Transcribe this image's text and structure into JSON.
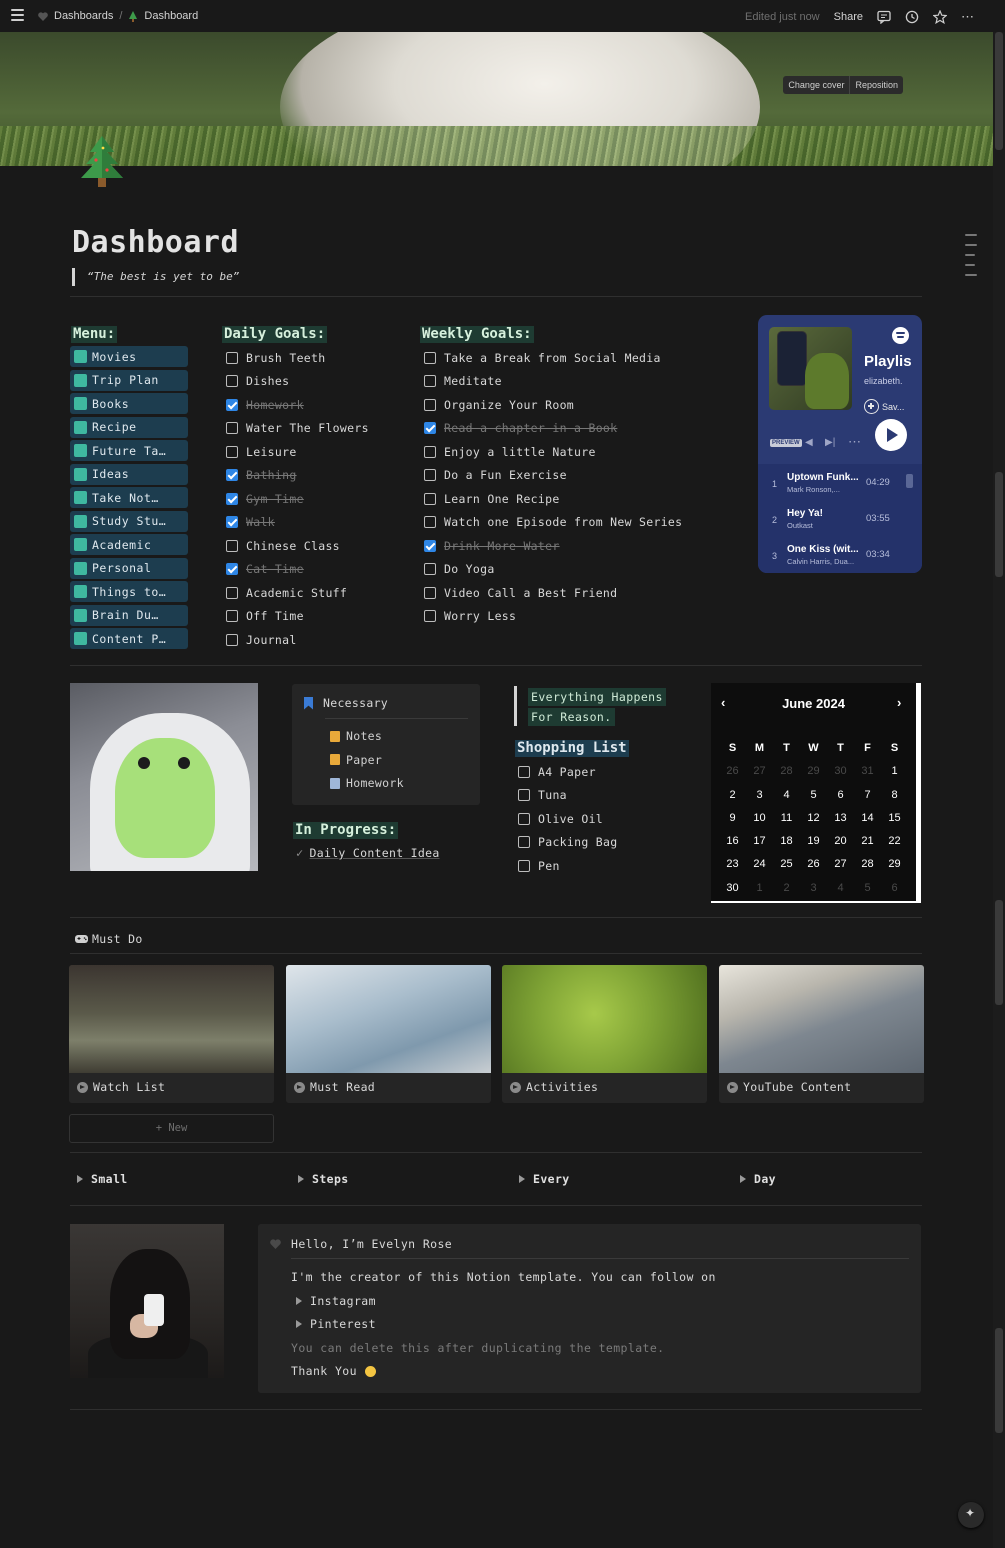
{
  "topbar": {
    "crumb1": "Dashboards",
    "crumb2": "Dashboard",
    "edited": "Edited just now",
    "share": "Share"
  },
  "cover": {
    "change": "Change cover",
    "reposition": "Reposition"
  },
  "page": {
    "title": "Dashboard",
    "quote": "“The best is yet to be”"
  },
  "menu": {
    "heading": "Menu:",
    "items": [
      {
        "label": "Movies",
        "color": "#3fb8a0"
      },
      {
        "label": "Trip Plan",
        "color": "#3fb8a0"
      },
      {
        "label": "Books",
        "color": "#3fb8a0"
      },
      {
        "label": "Recipe",
        "color": "#3fb8a0"
      },
      {
        "label": "Future Ta…",
        "color": "#3fb8a0"
      },
      {
        "label": "Ideas",
        "color": "#3fb8a0"
      },
      {
        "label": "Take Not…",
        "color": "#3fb8a0"
      },
      {
        "label": "Study Stu…",
        "color": "#3fb8a0"
      },
      {
        "label": "Academic",
        "color": "#3fb8a0"
      },
      {
        "label": "Personal",
        "color": "#3fb8a0"
      },
      {
        "label": "Things to…",
        "color": "#3fb8a0"
      },
      {
        "label": "Brain Du…",
        "color": "#3fb8a0"
      },
      {
        "label": "Content P…",
        "color": "#3fb8a0"
      }
    ]
  },
  "daily": {
    "heading": "Daily Goals:",
    "items": [
      {
        "label": "Brush Teeth",
        "done": false
      },
      {
        "label": "Dishes",
        "done": false
      },
      {
        "label": "Homework",
        "done": true
      },
      {
        "label": "Water The Flowers",
        "done": false
      },
      {
        "label": "Leisure",
        "done": false
      },
      {
        "label": "Bathing",
        "done": true
      },
      {
        "label": "Gym Time",
        "done": true
      },
      {
        "label": "Walk",
        "done": true
      },
      {
        "label": "Chinese Class",
        "done": false
      },
      {
        "label": "Cat Time",
        "done": true
      },
      {
        "label": "Academic Stuff",
        "done": false
      },
      {
        "label": "Off Time",
        "done": false
      },
      {
        "label": "Journal",
        "done": false
      }
    ]
  },
  "weekly": {
    "heading": "Weekly Goals:",
    "items": [
      {
        "label": "Take a Break from Social Media",
        "done": false
      },
      {
        "label": "Meditate",
        "done": false
      },
      {
        "label": "Organize Your Room",
        "done": false
      },
      {
        "label": "Read a chapter in a Book",
        "done": true
      },
      {
        "label": "Enjoy a little Nature",
        "done": false
      },
      {
        "label": "Do a Fun Exercise",
        "done": false
      },
      {
        "label": "Learn One Recipe",
        "done": false
      },
      {
        "label": "Watch one Episode from New Series",
        "done": false
      },
      {
        "label": "Drink More Water",
        "done": true
      },
      {
        "label": "Do Yoga",
        "done": false
      },
      {
        "label": "Video Call a Best Friend",
        "done": false
      },
      {
        "label": "Worry Less",
        "done": false
      }
    ]
  },
  "spotify": {
    "title": "Playlis",
    "user": "elizabeth.",
    "save": "Sav...",
    "preview": "PREVIEW",
    "tracks": [
      {
        "n": "1",
        "name": "Uptown Funk...",
        "artist": "Mark Ronson,...",
        "dur": "04:29"
      },
      {
        "n": "2",
        "name": "Hey Ya!",
        "artist": "Outkast",
        "dur": "03:55"
      },
      {
        "n": "3",
        "name": "One Kiss (wit...",
        "artist": "Calvin Harris, Dua...",
        "dur": "03:34"
      }
    ]
  },
  "necessary": {
    "title": "Necessary",
    "items": [
      {
        "label": "Notes",
        "color": "#e8a93a"
      },
      {
        "label": "Paper",
        "color": "#e8a93a"
      },
      {
        "label": "Homework",
        "color": "#9fb7d8"
      }
    ]
  },
  "inprogress": {
    "heading": "In Progress:",
    "item": "Daily Content Idea"
  },
  "quote2": {
    "line1": "Everything Happens",
    "line2": "For Reason."
  },
  "shopping": {
    "heading": "Shopping List",
    "items": [
      "A4 Paper",
      "Tuna",
      "Olive Oil",
      "Packing Bag",
      "Pen"
    ]
  },
  "calendar": {
    "month": "June 2024",
    "dow": [
      "S",
      "M",
      "T",
      "W",
      "T",
      "F",
      "S"
    ],
    "days": [
      {
        "d": "26",
        "m": true
      },
      {
        "d": "27",
        "m": true
      },
      {
        "d": "28",
        "m": true
      },
      {
        "d": "29",
        "m": true
      },
      {
        "d": "30",
        "m": true
      },
      {
        "d": "31",
        "m": true
      },
      {
        "d": "1",
        "m": false
      },
      {
        "d": "2",
        "m": false
      },
      {
        "d": "3",
        "m": false
      },
      {
        "d": "4",
        "m": false
      },
      {
        "d": "5",
        "m": false
      },
      {
        "d": "6",
        "m": false
      },
      {
        "d": "7",
        "m": false
      },
      {
        "d": "8",
        "m": false
      },
      {
        "d": "9",
        "m": false
      },
      {
        "d": "10",
        "m": false
      },
      {
        "d": "11",
        "m": false
      },
      {
        "d": "12",
        "m": false
      },
      {
        "d": "13",
        "m": false
      },
      {
        "d": "14",
        "m": false
      },
      {
        "d": "15",
        "m": false
      },
      {
        "d": "16",
        "m": false
      },
      {
        "d": "17",
        "m": false
      },
      {
        "d": "18",
        "m": false
      },
      {
        "d": "19",
        "m": false
      },
      {
        "d": "20",
        "m": false
      },
      {
        "d": "21",
        "m": false
      },
      {
        "d": "22",
        "m": false
      },
      {
        "d": "23",
        "m": false
      },
      {
        "d": "24",
        "m": false
      },
      {
        "d": "25",
        "m": false
      },
      {
        "d": "26",
        "m": false
      },
      {
        "d": "27",
        "m": false
      },
      {
        "d": "28",
        "m": false
      },
      {
        "d": "29",
        "m": false
      },
      {
        "d": "30",
        "m": false
      },
      {
        "d": "1",
        "m": true
      },
      {
        "d": "2",
        "m": true
      },
      {
        "d": "3",
        "m": true
      },
      {
        "d": "4",
        "m": true
      },
      {
        "d": "5",
        "m": true
      },
      {
        "d": "6",
        "m": true
      }
    ]
  },
  "mustdo": {
    "title": "Must Do",
    "cards": [
      "Watch List",
      "Must Read",
      "Activities",
      "YouTube Content"
    ],
    "new": "+ New"
  },
  "toggles": [
    "Small",
    "Steps",
    "Every",
    "Day"
  ],
  "hello": {
    "title": "Hello, I’m Evelyn Rose",
    "line1": "I'm the creator of this Notion template. You can follow on",
    "instagram": "Instagram",
    "pinterest": "Pinterest",
    "note": "You can delete this after duplicating the template.",
    "thanks": "Thank You"
  }
}
